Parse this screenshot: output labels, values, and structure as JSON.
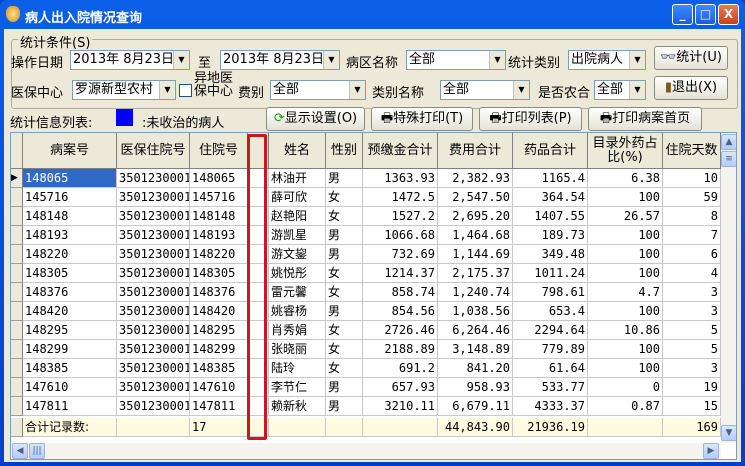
{
  "window": {
    "title": "病人出入院情况查询",
    "minimize": "_",
    "maximize": "□",
    "close": "X"
  },
  "conditions": {
    "legend": "统计条件(S)",
    "op_date_label": "操作日期",
    "date_from": "2013年  8月23日",
    "to_label": "至",
    "date_to": "2013年  8月23日",
    "ward_label": "病区名称",
    "ward_value": "全部",
    "stat_type_label": "统计类别",
    "stat_type_value": "出院病人",
    "stat_button": "统计(U)",
    "insurance_center_label": "医保中心",
    "insurance_center_value": "罗源新型农村",
    "remote_checkbox_label": "异地医保中心",
    "remote_checked": false,
    "fee_type_label": "费别",
    "fee_type_value": "全部",
    "category_label": "类别名称",
    "category_value": "全部",
    "rural_label": "是否农合",
    "rural_value": "全部",
    "exit_button": "退出(X)"
  },
  "info": {
    "list_label": "统计信息列表:",
    "legend_color": "#0000ff",
    "legend_text": ":未收治的病人",
    "display_settings": "显示设置(O)",
    "special_print": "特殊打印(T)",
    "print_list": "打印列表(P)",
    "print_first_page": "打印病案首页"
  },
  "table": {
    "columns": [
      "病案号",
      "医保住院号",
      "住院号",
      "",
      "姓名",
      "性别",
      "预缴金合计",
      "费用合计",
      "药品合计",
      "目录外药占比(%)",
      "住院天数"
    ],
    "rows": [
      [
        "148065",
        "3501230001",
        "148065",
        "",
        "林油开",
        "男",
        "1363.93",
        "2,382.93",
        "1165.4",
        "6.38",
        "10"
      ],
      [
        "145716",
        "3501230001",
        "145716",
        "",
        "薛可欣",
        "女",
        "1472.5",
        "2,547.50",
        "364.54",
        "100",
        "59"
      ],
      [
        "148148",
        "3501230001",
        "148148",
        "",
        "赵艳阳",
        "女",
        "1527.2",
        "2,695.20",
        "1407.55",
        "26.57",
        "8"
      ],
      [
        "148193",
        "3501230001",
        "148193",
        "",
        "游凯星",
        "男",
        "1066.68",
        "1,464.68",
        "189.73",
        "100",
        "7"
      ],
      [
        "148220",
        "3501230001",
        "148220",
        "",
        "游文鋆",
        "男",
        "732.69",
        "1,144.69",
        "349.48",
        "100",
        "6"
      ],
      [
        "148305",
        "3501230001",
        "148305",
        "",
        "姚悦彤",
        "女",
        "1214.37",
        "2,175.37",
        "1011.24",
        "100",
        "4"
      ],
      [
        "148376",
        "3501230001",
        "148376",
        "",
        "雷元馨",
        "女",
        "858.74",
        "1,240.74",
        "798.61",
        "4.7",
        "3"
      ],
      [
        "148420",
        "3501230001",
        "148420",
        "",
        "姚睿杨",
        "男",
        "854.56",
        "1,038.56",
        "653.4",
        "100",
        "3"
      ],
      [
        "148295",
        "3501230001",
        "148295",
        "",
        "肖秀娟",
        "女",
        "2726.46",
        "6,264.46",
        "2294.64",
        "10.86",
        "5"
      ],
      [
        "148299",
        "3501230001",
        "148299",
        "",
        "张晓丽",
        "女",
        "2188.89",
        "3,148.89",
        "779.89",
        "100",
        "5"
      ],
      [
        "148385",
        "3501230001",
        "148385",
        "",
        "陆玲",
        "女",
        "691.2",
        "841.20",
        "61.64",
        "100",
        "3"
      ],
      [
        "147610",
        "3501230001",
        "147610",
        "",
        "李节仁",
        "男",
        "657.93",
        "958.93",
        "533.77",
        "0",
        "19"
      ],
      [
        "147811",
        "3501230001",
        "147811",
        "",
        "赖新秋",
        "男",
        "3210.11",
        "6,679.11",
        "4333.37",
        "0.87",
        "15"
      ]
    ],
    "total_row": [
      "合计记录数:",
      "",
      "17",
      "",
      "",
      "",
      "",
      "44,843.90",
      "21936.19",
      "",
      "169"
    ],
    "selected_row": 0,
    "highlight_color": "#d0161a"
  }
}
